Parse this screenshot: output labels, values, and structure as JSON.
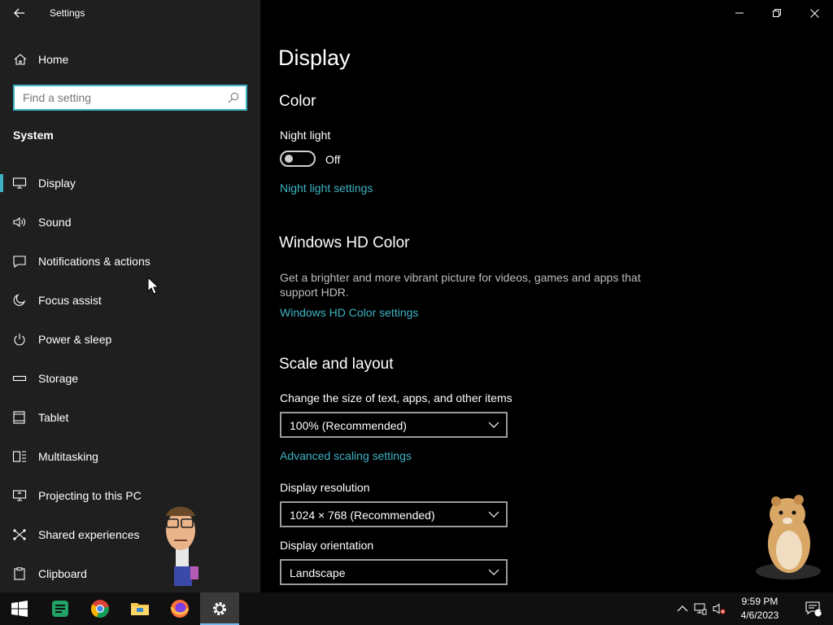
{
  "app": {
    "title": "Settings"
  },
  "sidebar": {
    "home_label": "Home",
    "search_placeholder": "Find a setting",
    "section_title": "System",
    "items": [
      {
        "label": "Display",
        "icon": "monitor-icon",
        "active": true
      },
      {
        "label": "Sound",
        "icon": "speaker-icon"
      },
      {
        "label": "Notifications & actions",
        "icon": "notification-icon"
      },
      {
        "label": "Focus assist",
        "icon": "moon-icon"
      },
      {
        "label": "Power & sleep",
        "icon": "power-icon"
      },
      {
        "label": "Storage",
        "icon": "storage-icon"
      },
      {
        "label": "Tablet",
        "icon": "tablet-icon"
      },
      {
        "label": "Multitasking",
        "icon": "multitasking-icon"
      },
      {
        "label": "Projecting to this PC",
        "icon": "projecting-icon"
      },
      {
        "label": "Shared experiences",
        "icon": "shared-experiences-icon"
      },
      {
        "label": "Clipboard",
        "icon": "clipboard-icon"
      }
    ]
  },
  "main": {
    "page_title": "Display",
    "color": {
      "heading": "Color",
      "night_light_label": "Night light",
      "night_light_state": "Off",
      "night_light_on": false,
      "night_light_settings_link": "Night light settings"
    },
    "hd_color": {
      "heading": "Windows HD Color",
      "description": "Get a brighter and more vibrant picture for videos, games and apps that support HDR.",
      "link": "Windows HD Color settings"
    },
    "scale_layout": {
      "heading": "Scale and layout",
      "size_label": "Change the size of text, apps, and other items",
      "size_value": "100% (Recommended)",
      "advanced_link": "Advanced scaling settings",
      "resolution_label": "Display resolution",
      "resolution_value": "1024 × 768 (Recommended)",
      "orientation_label": "Display orientation",
      "orientation_value": "Landscape"
    }
  },
  "taskbar": {
    "time": "9:59 PM",
    "date": "4/6/2023",
    "notification_count": "1"
  },
  "colors": {
    "accent": "#3db3c4",
    "sidebar_bg": "#1f1f1f",
    "main_bg": "#000000",
    "taskbar_bg": "#101010"
  }
}
